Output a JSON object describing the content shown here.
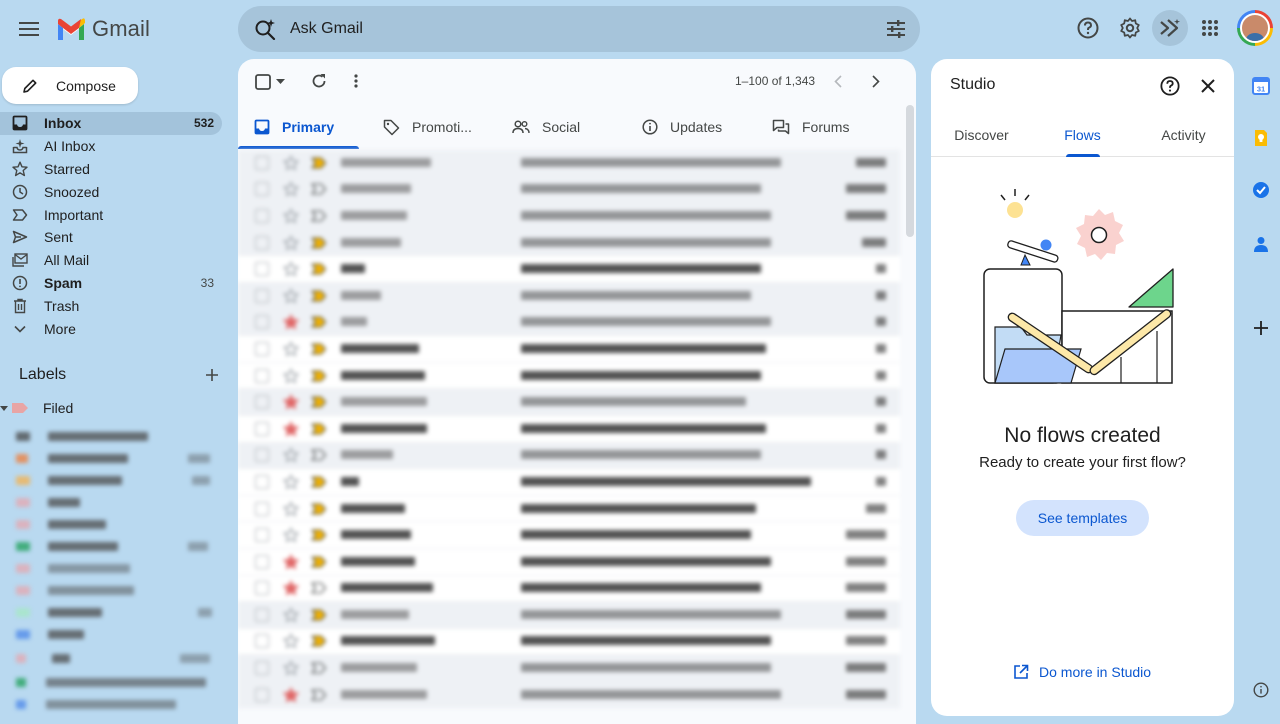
{
  "app": {
    "logo_text": "Gmail",
    "search_placeholder": "Ask Gmail"
  },
  "compose": {
    "label": "Compose"
  },
  "nav": {
    "items": [
      {
        "label": "Inbox",
        "count": "532"
      },
      {
        "label": "AI Inbox",
        "count": ""
      },
      {
        "label": "Starred",
        "count": ""
      },
      {
        "label": "Snoozed",
        "count": ""
      },
      {
        "label": "Important",
        "count": ""
      },
      {
        "label": "Sent",
        "count": ""
      },
      {
        "label": "All Mail",
        "count": ""
      },
      {
        "label": "Spam",
        "count": "33"
      },
      {
        "label": "Trash",
        "count": ""
      },
      {
        "label": "More",
        "count": ""
      }
    ]
  },
  "labels": {
    "title": "Labels",
    "filed": "Filed"
  },
  "mail": {
    "pager": "1–100 of 1,343",
    "tabs": [
      {
        "label": "Primary"
      },
      {
        "label": "Promoti..."
      },
      {
        "label": "Social"
      },
      {
        "label": "Updates"
      },
      {
        "label": "Forums"
      }
    ]
  },
  "studio": {
    "title": "Studio",
    "tabs": [
      {
        "label": "Discover"
      },
      {
        "label": "Flows"
      },
      {
        "label": "Activity"
      }
    ],
    "empty_title": "No flows created",
    "empty_subtitle": "Ready to create your first flow?",
    "see_templates": "See templates",
    "do_more": "Do more in Studio"
  },
  "colors": {
    "accent": "#0b57d0",
    "background": "#b9d9f0",
    "star_active": "#e06666",
    "important_marker": "#f6b500"
  }
}
